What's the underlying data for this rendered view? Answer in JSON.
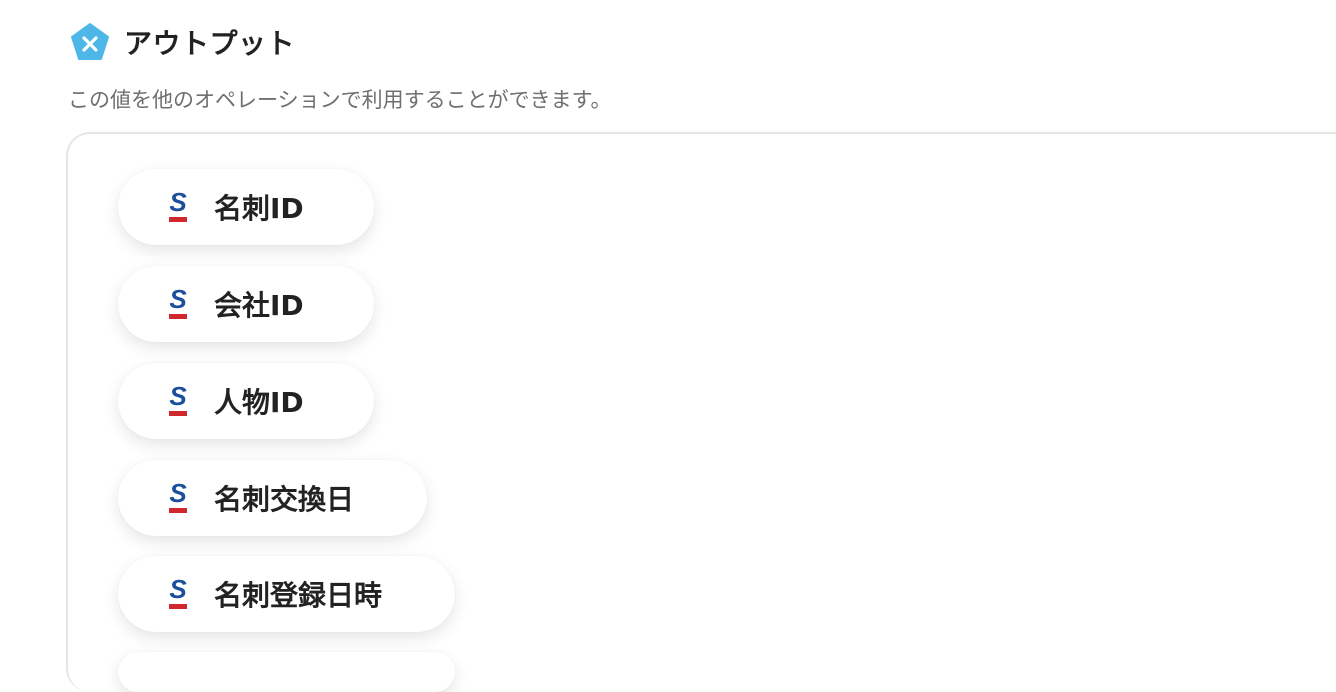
{
  "header": {
    "title": "アウトプット",
    "icon": "app-logo-icon",
    "accent": "#4db7e8"
  },
  "subtitle": "この値を他のオペレーションで利用することができます。",
  "outputs": [
    {
      "label": "名刺ID",
      "icon": "sansan-icon"
    },
    {
      "label": "会社ID",
      "icon": "sansan-icon"
    },
    {
      "label": "人物ID",
      "icon": "sansan-icon"
    },
    {
      "label": "名刺交換日",
      "icon": "sansan-icon"
    },
    {
      "label": "名刺登録日時",
      "icon": "sansan-icon"
    }
  ],
  "colors": {
    "sansan_blue": "#1b4f9c",
    "sansan_red": "#d0282d"
  }
}
